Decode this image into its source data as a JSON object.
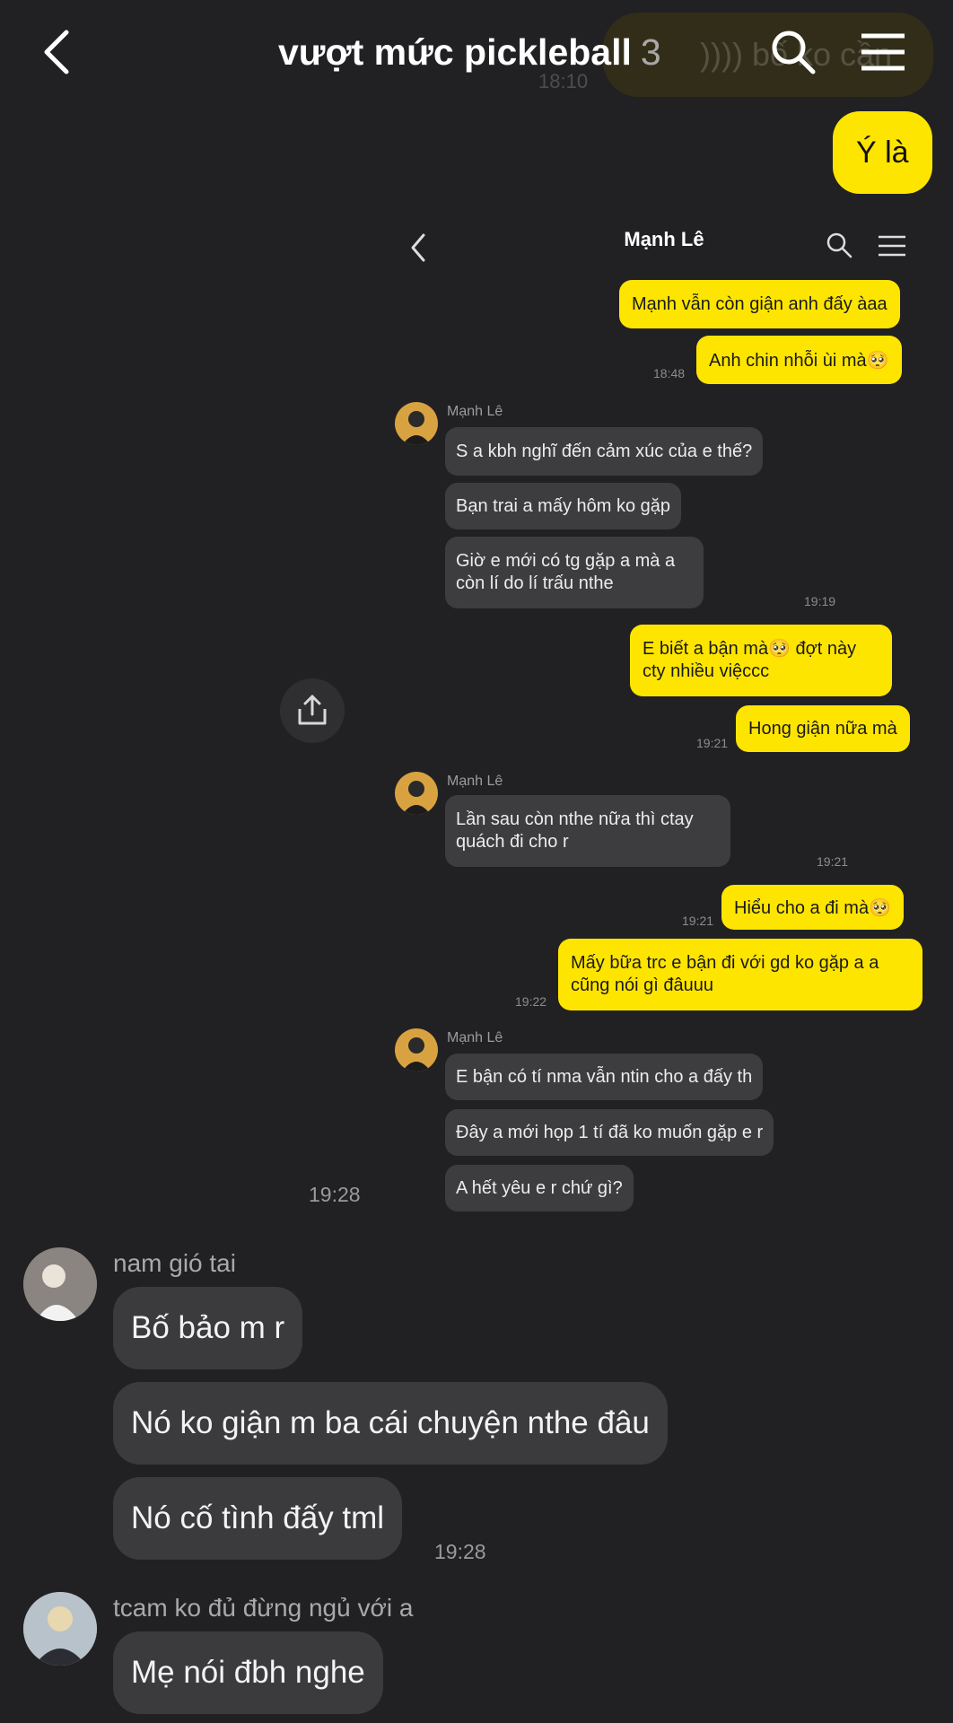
{
  "header": {
    "title": "vượt mức pickleball",
    "member_count": "3",
    "back_icon": "chevron-left-icon",
    "search_icon": "search-icon",
    "menu_icon": "hamburger-menu-icon",
    "behind_text": ")))) bố ko cần",
    "behind_time": "18:10"
  },
  "messages": {
    "me_1": "Ý là",
    "embedded_time": "19:28",
    "sender_1_name": "nam gió tai",
    "sender_1_msgs": [
      "Bố bảo m r",
      "Nó ko giận m ba cái chuyện nthe đâu",
      "Nó cố tình đấy tml"
    ],
    "sender_1_time": "19:28",
    "sender_2_name": "tcam ko đủ đừng ngủ với a",
    "sender_2_msgs": [
      "Mẹ nói đbh nghe"
    ]
  },
  "screenshot": {
    "title": "Mạnh Lê",
    "contact_name": "Mạnh Lê",
    "me_a": "Mạnh vẫn còn giận anh đấy àaa",
    "me_b": "Anh chin nhỗi ùi mà🥺",
    "time_a": "18:48",
    "other_a": [
      "S a kbh nghĩ đến cảm xúc của e thế?",
      "Bạn trai a mấy hôm ko gặp",
      "Giờ e mới có tg gặp a mà a còn lí do lí trấu nthe"
    ],
    "time_b": "19:19",
    "me_c": "E biết a bận mà🥺 đợt này cty nhiều việccc",
    "me_d": "Hong giận nữa mà",
    "time_c": "19:21",
    "other_b": "Lần sau còn nthe nữa thì ctay quách đi cho r",
    "time_d": "19:21",
    "me_e": "Hiểu cho a đi mà🥺",
    "time_e": "19:21",
    "me_f": "Mấy bữa trc e bận đi với gd ko gặp a a cũng nói gì đâuuu",
    "time_f": "19:22",
    "other_c": [
      "E bận có tí nma vẫn ntin cho a đấy th",
      "Đây a mới họp 1 tí đã ko muốn gặp e r",
      "A hết yêu e r chứ gì?"
    ]
  },
  "colors": {
    "background": "#212123",
    "my_bubble": "#fee500",
    "other_bubble": "#3b3b3d"
  }
}
